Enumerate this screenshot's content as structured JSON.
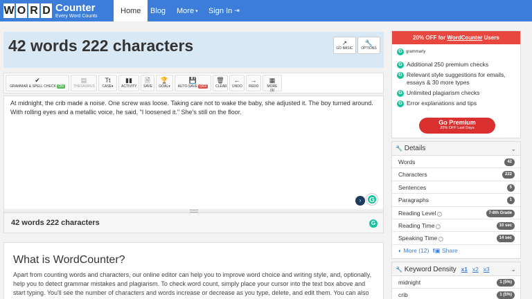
{
  "nav": {
    "logo_letters": [
      "W",
      "O",
      "R",
      "D"
    ],
    "logo_main": "Counter",
    "logo_sub": "Every Word Counts",
    "items": [
      "Home",
      "Blog",
      "More",
      "Sign In"
    ]
  },
  "header": {
    "title": "42 words 222 characters",
    "go_basic": "GO BASIC",
    "options": "OPTIONS"
  },
  "toolbar": {
    "grammar": "GRAMMAR & SPELL CHECK",
    "grammar_badge": "ON",
    "thesaurus": "THESAURUS",
    "case": "CASE",
    "activity": "ACTIVITY",
    "save": "SAVE",
    "goal": "GOAL",
    "autosave": "AUTO-SAVE",
    "autosave_badge": "OFF",
    "clear": "CLEAR",
    "undo": "UNDO",
    "redo": "REDO",
    "more": "MORE (9)"
  },
  "editor": {
    "text": "At midnight, the crib made a noise. One screw was loose. Taking care not to wake the baby, she adjusted it. The boy turned around. With rolling eyes and a metallic voice, he said, \"I loosened it.\" She's still on the floor."
  },
  "stats": {
    "summary": "42 words 222 characters"
  },
  "about": {
    "title": "What is WordCounter?",
    "body": "Apart from counting words and characters, our online editor can help you to improve word choice and writing style, and, optionally, help you to detect grammar mistakes and plagiarism. To check word count, simply place your cursor into the text box above and start typing. You'll see the number of characters and words increase or decrease as you type, delete, and edit them. You can also"
  },
  "promo": {
    "banner_pre": "20% OFF for ",
    "banner_brand": "WordCounter",
    "banner_post": " Users",
    "brand": "grammarly",
    "items": [
      "Additional 250 premium checks",
      "Relevant style suggestions for emails, essays & 30 more types",
      "Unlimited plagiarism checks",
      "Error explanations and tips"
    ],
    "cta": "Go Premium",
    "cta_sub": "20% OFF Last Days"
  },
  "details": {
    "title": "Details",
    "rows": [
      {
        "label": "Words",
        "value": "42"
      },
      {
        "label": "Characters",
        "value": "222"
      },
      {
        "label": "Sentences",
        "value": "5"
      },
      {
        "label": "Paragraphs",
        "value": "1"
      },
      {
        "label": "Reading Level",
        "value": "7-8th Grade"
      },
      {
        "label": "Reading Time",
        "value": "10 sec"
      },
      {
        "label": "Speaking Time",
        "value": "14 sec"
      }
    ],
    "more": "More (12)",
    "share": "Share"
  },
  "keyword": {
    "title": "Keyword Density",
    "tabs": [
      "x1",
      "x2",
      "x3"
    ],
    "rows": [
      {
        "label": "midnight",
        "value": "1 (5%)"
      },
      {
        "label": "crib",
        "value": "1 (5%)"
      }
    ]
  }
}
